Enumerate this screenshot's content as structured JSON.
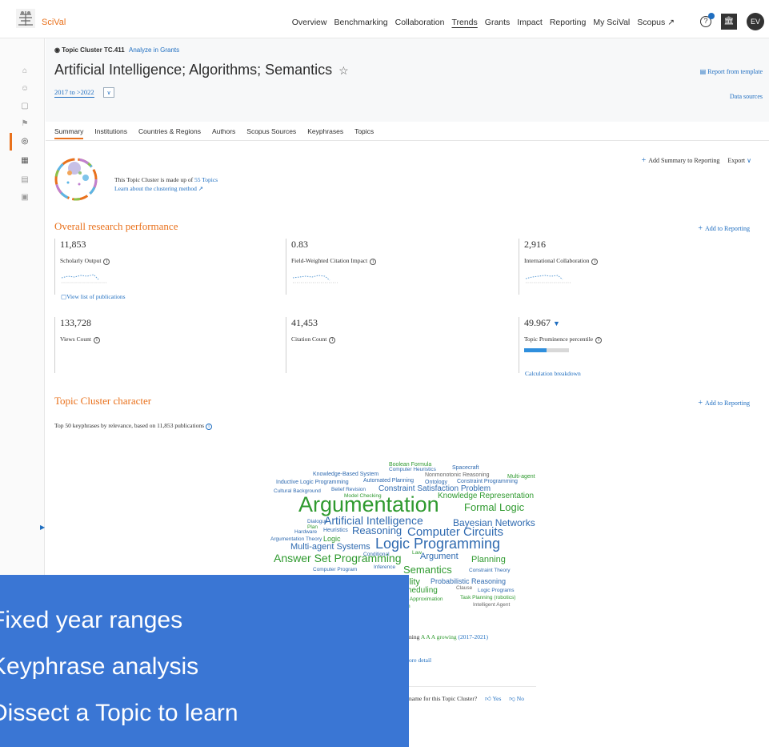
{
  "app": {
    "brand": "SciVal",
    "nav": [
      "Overview",
      "Benchmarking",
      "Collaboration",
      "Trends",
      "Grants",
      "Impact",
      "Reporting",
      "My SciVal",
      "Scopus ↗"
    ],
    "nav_active": "Trends",
    "avatar_initials": "EV",
    "icons": [
      "help-icon",
      "institution-icon"
    ]
  },
  "header": {
    "eyebrow": "Topic Cluster TC.411",
    "eyebrow_link": "Analyze in Grants",
    "title": "Artificial Intelligence; Algorithms; Semantics",
    "year_range": "2017 to >2022",
    "report_template": "Report from template",
    "data_sources": "Data sources"
  },
  "tabs": [
    "Summary",
    "Institutions",
    "Countries & Regions",
    "Authors",
    "Scopus Sources",
    "Keyphrases",
    "Topics"
  ],
  "summary": {
    "add_summary": "Add Summary to Reporting",
    "export": "Export",
    "cluster_text_prefix": "This Topic Cluster is made up of",
    "cluster_topics_link": "55 Topics",
    "clustering_link": "Learn about the clustering method ↗"
  },
  "performance": {
    "title": "Overall research performance",
    "add_to_reporting": "Add to Reporting",
    "view_publications": "View list of publications",
    "metrics": [
      {
        "value": "11,853",
        "label": "Scholarly Output"
      },
      {
        "value": "0.83",
        "label": "Field-Weighted Citation Impact"
      },
      {
        "value": "2,916",
        "label": "International Collaboration"
      },
      {
        "value": "133,728",
        "label": "Views Count"
      },
      {
        "value": "41,453",
        "label": "Citation Count"
      },
      {
        "value": "49.967",
        "label": "Topic Prominence percentile",
        "percentile": 49.967
      }
    ],
    "calculation_breakdown": "Calculation breakdown"
  },
  "character": {
    "title": "Topic Cluster character",
    "add_to_reporting": "Add to Reporting",
    "caption": "Top 50 keyphrases by relevance, based on 11,853 publications",
    "keyphrases": [
      "Boolean Formula",
      "Spacecraft",
      "Computer Heuristics",
      "Knowledge-Based System",
      "Nonmonotonic Reasoning",
      "Multi-agent",
      "Inductive Logic Programming",
      "Automated Planning",
      "Ontology",
      "Constraint Programming",
      "Cultural Background",
      "Belief Revision",
      "Constraint Satisfaction Problem",
      "Model Checking",
      "Knowledge Representation",
      "Argumentation",
      "Formal Logic",
      "Dialogue",
      "Artificial Intelligence",
      "Bayesian Networks",
      "Plan",
      "Hardware",
      "Heuristics",
      "Reasoning",
      "Computer Circuits",
      "Argumentation Theory",
      "Logic",
      "Logic Programming",
      "Multi-agent Systems",
      "Conditional",
      "Law",
      "Answer Set Programming",
      "Argument",
      "Planning",
      "Computer Program",
      "Inference",
      "Semantics",
      "Constraint Theory",
      "ility",
      "Probabilistic Reasoning",
      "Clause",
      "heduling",
      "Logic Programs",
      "l Approximation",
      "Task Planning (robotics)",
      "Intelligent Agent",
      "n"
    ],
    "growing_prefix": "ning",
    "growing_label": "A A A growing",
    "growing_years": "(2017-2021)",
    "more_detail": "ore detail",
    "name_question": "name for this Topic Cluster?",
    "yes": "Yes",
    "no": "No"
  },
  "overlay": {
    "lines": [
      "Fixed year ranges",
      "Keyphrase analysis",
      "Dissect a Topic to learn"
    ]
  }
}
